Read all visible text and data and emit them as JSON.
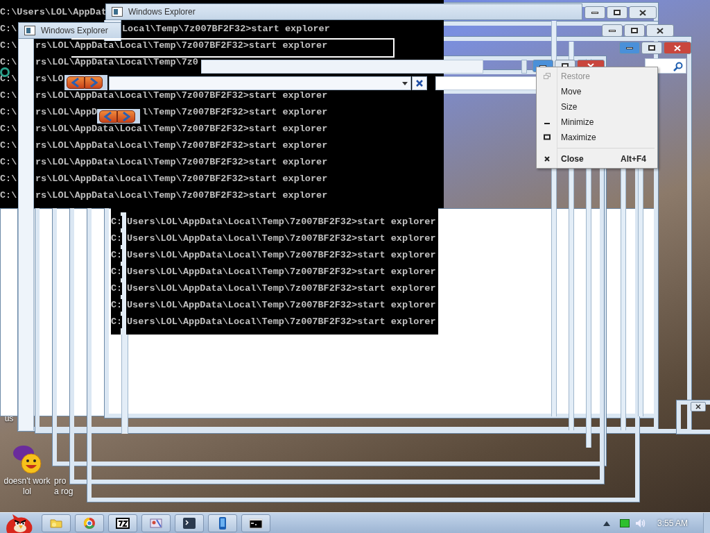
{
  "windows": [
    {
      "title": "Windows Explorer"
    },
    {
      "title": "Windows Explorer"
    }
  ],
  "console_top": {
    "rows": [
      [
        {
          "kind": "edge",
          "text": "C:\\Users\\LOL\\AppDat"
        }
      ],
      [
        {
          "kind": "edge",
          "text": "C:\\"
        },
        {
          "kind": "past-title",
          "text": "Local\\Temp\\7z007BF2F32>start explorer"
        }
      ],
      [
        {
          "kind": "edge",
          "text": "C:\\"
        },
        {
          "kind": "past-frame",
          "text": "rs\\LOL\\AppData\\Local\\Temp\\7z007BF2F32>start explorer"
        }
      ],
      [
        {
          "kind": "edge",
          "text": "C:\\"
        },
        {
          "kind": "past-frame",
          "text": "rs\\LOL\\AppData\\Local\\Temp\\7z0"
        }
      ],
      [
        {
          "kind": "edge",
          "text": "C:\\"
        },
        {
          "kind": "past-frame",
          "text": "rs\\LO"
        }
      ],
      [
        {
          "kind": "edge",
          "text": "C:\\"
        },
        {
          "kind": "past-frame",
          "text": "rs\\LOL\\AppData\\Local\\Temp\\7z007BF2F32>start explorer"
        }
      ],
      [
        {
          "kind": "edge",
          "text": "C:\\"
        },
        {
          "kind": "past-frame",
          "text": "rs\\LOL\\AppD"
        },
        {
          "kind": "past-arrows",
          "text": "l\\Temp\\7z007BF2F32>start explorer"
        }
      ],
      [
        {
          "kind": "edge",
          "text": "C:\\"
        },
        {
          "kind": "past-frame",
          "text": "rs\\LOL\\AppData\\Local\\Temp\\7z007BF2F32>start explorer"
        }
      ],
      [
        {
          "kind": "edge",
          "text": "C:\\"
        },
        {
          "kind": "past-frame",
          "text": "rs\\LOL\\AppData\\Local\\Temp\\7z007BF2F32>start explorer"
        }
      ],
      [
        {
          "kind": "edge",
          "text": "C:\\"
        },
        {
          "kind": "past-frame",
          "text": "rs\\LOL\\AppData\\Local\\Temp\\7z007BF2F32>start explorer"
        }
      ],
      [
        {
          "kind": "edge",
          "text": "C:\\"
        },
        {
          "kind": "past-frame",
          "text": "rs\\LOL\\AppData\\Local\\Temp\\7z007BF2F32>start explorer"
        }
      ],
      [
        {
          "kind": "edge",
          "text": "C:\\"
        },
        {
          "kind": "past-frame",
          "text": "rs\\LOL\\AppData\\Local\\Temp\\7z007BF2F32>start explorer"
        }
      ]
    ]
  },
  "console_bottom": {
    "rows": [
      [
        {
          "kind": "edge",
          "text": "C:"
        },
        {
          "kind": "past-frame",
          "text": "Users\\LOL\\AppData\\Local\\Temp\\7z007BF2F32>start explorer"
        }
      ],
      [
        {
          "kind": "edge",
          "text": "C:"
        },
        {
          "kind": "past-frame",
          "text": "Users\\LOL\\AppData\\Local\\Temp\\7z007BF2F32>start explorer"
        }
      ],
      [
        {
          "kind": "edge",
          "text": "C:"
        },
        {
          "kind": "past-frame",
          "text": "Users\\LOL\\AppData\\Local\\Temp\\7z007BF2F32>start explorer"
        }
      ],
      [
        {
          "kind": "edge",
          "text": "C:"
        },
        {
          "kind": "past-frame",
          "text": "Users\\LOL\\AppData\\Local\\Temp\\7z007BF2F32>start explorer"
        }
      ],
      [
        {
          "kind": "edge",
          "text": "C:"
        },
        {
          "kind": "past-frame",
          "text": "Users\\LOL\\AppData\\Local\\Temp\\7z007BF2F32>start explorer"
        }
      ],
      [
        {
          "kind": "edge",
          "text": "C:"
        },
        {
          "kind": "past-frame",
          "text": "Users\\LOL\\AppData\\Local\\Temp\\7z007BF2F32>start explorer"
        }
      ],
      [
        {
          "kind": "edge",
          "text": "C:"
        },
        {
          "kind": "past-frame",
          "text": "Users\\LOL\\AppData\\Local\\Temp\\7z007BF2F32>start explorer"
        }
      ]
    ]
  },
  "context_menu": {
    "items": [
      {
        "kind": "restore",
        "label": "Restore",
        "disabled": true,
        "default": false
      },
      {
        "kind": "move",
        "label": "Move",
        "disabled": false,
        "default": false
      },
      {
        "kind": "size",
        "label": "Size",
        "disabled": false,
        "default": false
      },
      {
        "kind": "minimize",
        "label": "Minimize",
        "disabled": false,
        "default": false
      },
      {
        "kind": "maximize",
        "label": "Maximize",
        "disabled": false,
        "default": false
      },
      {
        "kind": "separator"
      },
      {
        "kind": "close",
        "label": "Close",
        "shortcut": "Alt+F4",
        "disabled": false,
        "default": true
      }
    ]
  },
  "desktop_icons": [
    {
      "kind": "partial",
      "lines": [
        "us"
      ]
    },
    {
      "kind": "messenger",
      "lines": [
        "doesn't work",
        "lol"
      ]
    },
    {
      "kind": "partial",
      "lines": [
        "pro",
        "a rog"
      ]
    }
  ],
  "taskbar": {
    "buttons": [
      {
        "kind": "folder"
      },
      {
        "kind": "browser"
      },
      {
        "kind": "archiver"
      },
      {
        "kind": "paint"
      },
      {
        "kind": "terminal"
      },
      {
        "kind": "phone"
      },
      {
        "kind": "console"
      }
    ],
    "clock": "3:55 AM"
  }
}
